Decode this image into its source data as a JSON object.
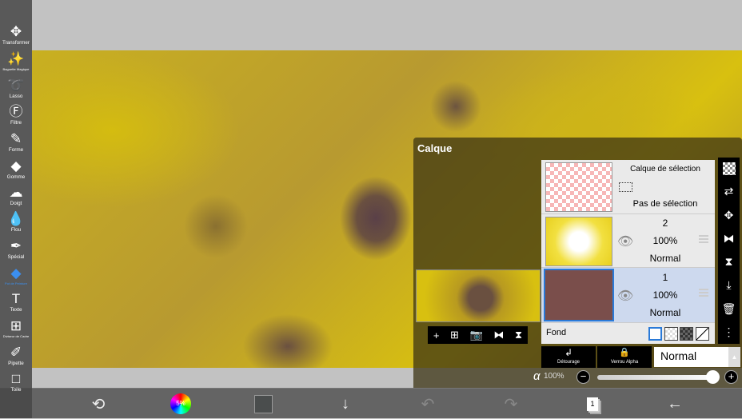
{
  "tools": [
    {
      "label": "Transformer",
      "icon": "move-arrows-icon",
      "glyph": "✥"
    },
    {
      "label": "Baguette Magique",
      "icon": "magic-wand-icon",
      "glyph": "✨"
    },
    {
      "label": "Lasso",
      "icon": "lasso-icon",
      "glyph": "➰"
    },
    {
      "label": "Filtre",
      "icon": "fx-icon",
      "glyph": "Ⓕ"
    },
    {
      "label": "Forme",
      "icon": "brush-icon",
      "glyph": "✎"
    },
    {
      "label": "Gomme",
      "icon": "eraser-icon",
      "glyph": "◆"
    },
    {
      "label": "Doigt",
      "icon": "smudge-icon",
      "glyph": "☁"
    },
    {
      "label": "Flou",
      "icon": "drop-icon",
      "glyph": "💧"
    },
    {
      "label": "Spécial",
      "icon": "special-pen-icon",
      "glyph": "✒"
    },
    {
      "label": "Pot de Peinture",
      "icon": "paint-bucket-icon",
      "glyph": "◆",
      "active": true
    },
    {
      "label": "Texte",
      "icon": "text-icon",
      "glyph": "T"
    },
    {
      "label": "Diviseur de Cadre",
      "icon": "frame-divider-icon",
      "glyph": "⊞"
    },
    {
      "label": "Pipette",
      "icon": "eyedropper-icon",
      "glyph": "✐"
    },
    {
      "label": "Toile",
      "icon": "canvas-icon",
      "glyph": "□"
    }
  ],
  "bottombar": {
    "color_percent": "5%",
    "current_color": "#4a4d4d",
    "layer_count": "1"
  },
  "panel": {
    "title": "Calque",
    "selection_layer": {
      "title": "Calque de sélection",
      "status": "Pas de sélection"
    },
    "layers": [
      {
        "name": "2",
        "opacity": "100%",
        "blend": "Normal"
      },
      {
        "name": "1",
        "opacity": "100%",
        "blend": "Normal",
        "color": "#7a4e4b",
        "selected": true
      }
    ],
    "fond_label": "Fond",
    "clipping_label": "Détourage",
    "alpha_lock_label": "Verrou Alpha",
    "blend_mode": "Normal",
    "alpha_symbol": "α",
    "opacity": "100%",
    "opacity_value": 1.0
  },
  "colors": {
    "accent": "#3b8ff0",
    "selected_layer_bg": "#cdd9ee"
  }
}
